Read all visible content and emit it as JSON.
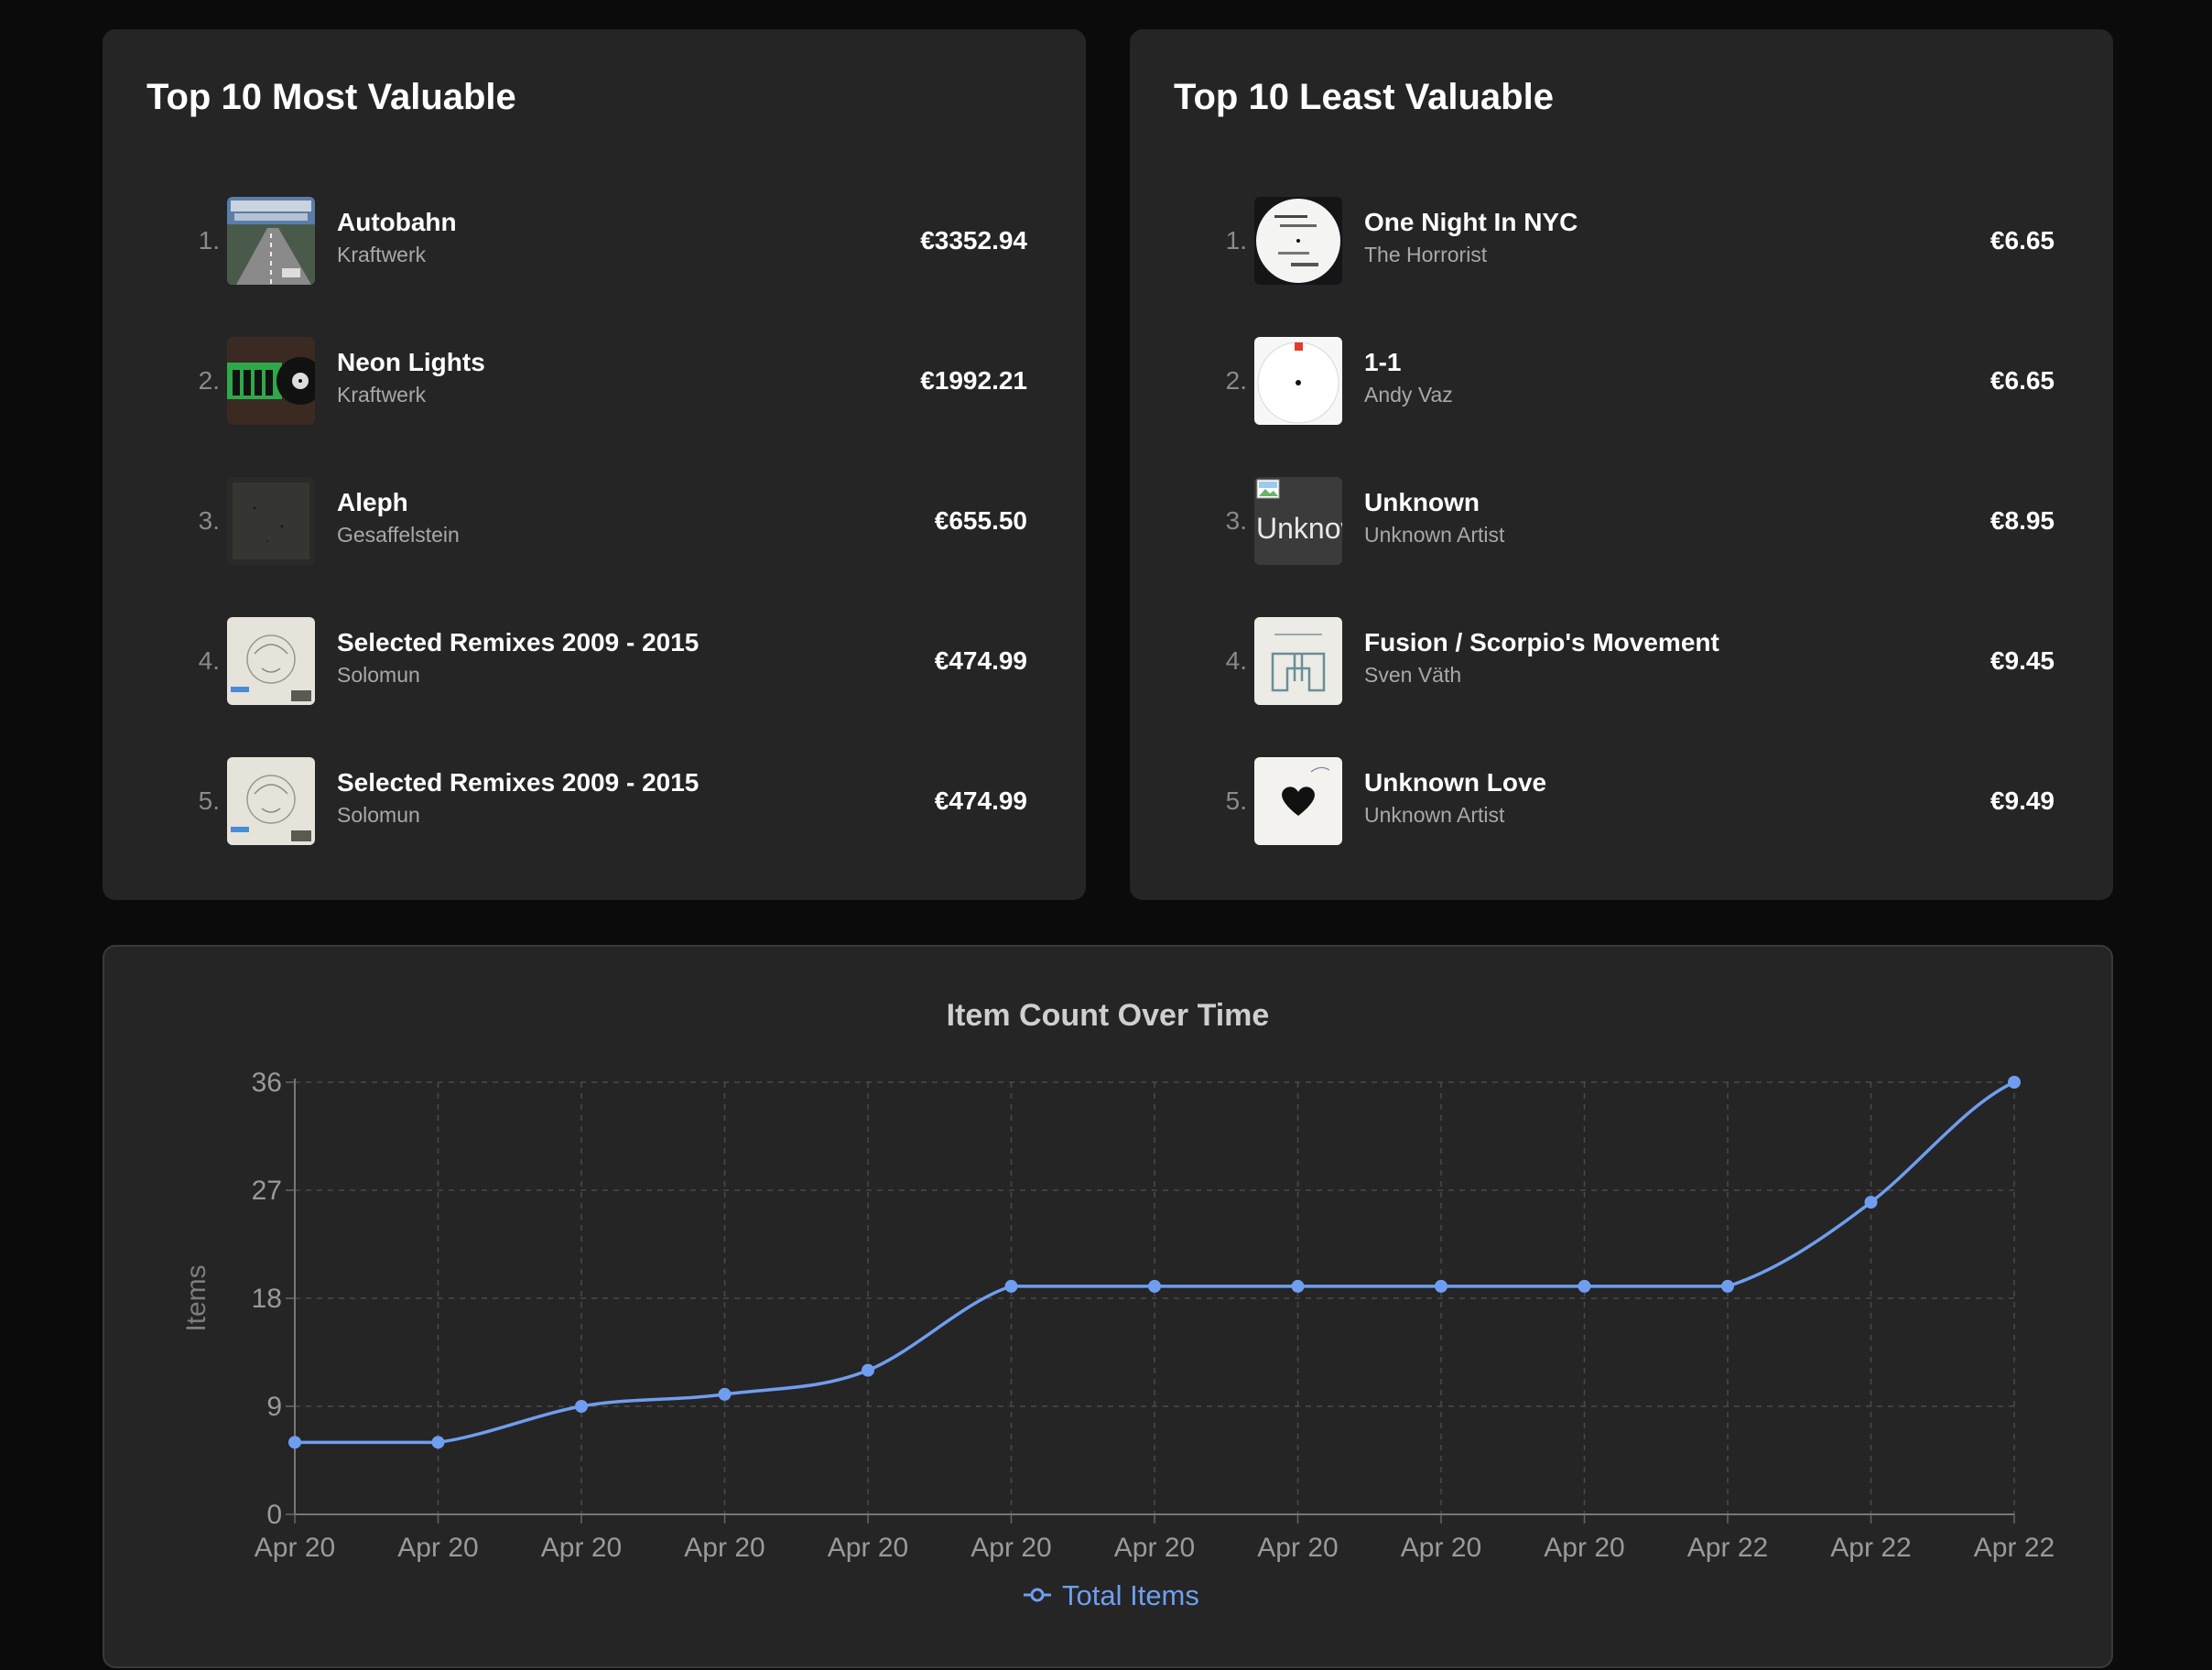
{
  "most_valuable": {
    "title": "Top 10 Most Valuable",
    "items": [
      {
        "rank": "1.",
        "title": "Autobahn",
        "artist": "Kraftwerk",
        "price": "€3352.94",
        "cover": "autobahn-cover"
      },
      {
        "rank": "2.",
        "title": "Neon Lights",
        "artist": "Kraftwerk",
        "price": "€1992.21",
        "cover": "neon-lights-cover"
      },
      {
        "rank": "3.",
        "title": "Aleph",
        "artist": "Gesaffelstein",
        "price": "€655.50",
        "cover": "aleph-cover"
      },
      {
        "rank": "4.",
        "title": "Selected Remixes 2009 - 2015",
        "artist": "Solomun",
        "price": "€474.99",
        "cover": "solomun-cover"
      },
      {
        "rank": "5.",
        "title": "Selected Remixes 2009 - 2015",
        "artist": "Solomun",
        "price": "€474.99",
        "cover": "solomun-cover"
      }
    ]
  },
  "least_valuable": {
    "title": "Top 10 Least Valuable",
    "items": [
      {
        "rank": "1.",
        "title": "One Night In NYC",
        "artist": "The Horrorist",
        "price": "€6.65",
        "cover": "white-label-cover"
      },
      {
        "rank": "2.",
        "title": "1-1",
        "artist": "Andy Vaz",
        "price": "€6.65",
        "cover": "white-sleeve-cover"
      },
      {
        "rank": "3.",
        "title": "Unknown",
        "artist": "Unknown Artist",
        "price": "€8.95",
        "cover": "broken-image",
        "alt": "Unknow"
      },
      {
        "rank": "4.",
        "title": "Fusion / Scorpio's Movement",
        "artist": "Sven Väth",
        "price": "€9.45",
        "cover": "fusion-cover"
      },
      {
        "rank": "5.",
        "title": "Unknown Love",
        "artist": "Unknown Artist",
        "price": "€9.49",
        "cover": "heart-cover"
      }
    ]
  },
  "chart": {
    "title": "Item Count Over Time",
    "legend_label": "Total Items",
    "line_color": "#6f9ef0"
  },
  "chart_data": {
    "type": "line",
    "title": "Item Count Over Time",
    "xlabel": "",
    "ylabel": "Items",
    "categories": [
      "Apr 20",
      "Apr 20",
      "Apr 20",
      "Apr 20",
      "Apr 20",
      "Apr 20",
      "Apr 20",
      "Apr 20",
      "Apr 20",
      "Apr 20",
      "Apr 22",
      "Apr 22",
      "Apr 22"
    ],
    "series": [
      {
        "name": "Total Items",
        "values": [
          6,
          6,
          9,
          10,
          12,
          19,
          19,
          19,
          19,
          19,
          19,
          26,
          36
        ]
      }
    ],
    "yticks": [
      0,
      9,
      18,
      27,
      36
    ],
    "ylim": [
      0,
      36
    ],
    "grid": true,
    "legend": "bottom"
  }
}
